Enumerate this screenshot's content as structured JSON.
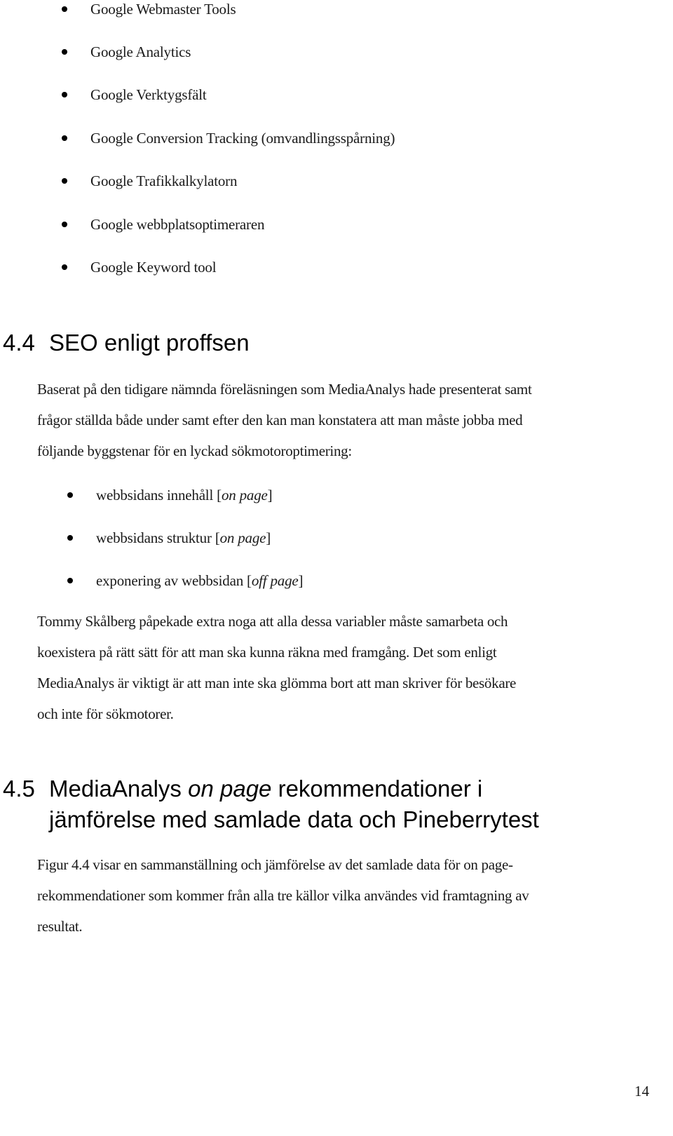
{
  "tools_list": {
    "items": [
      "Google Webmaster Tools",
      "Google Analytics",
      "Google Verktygsfält",
      "Google Conversion Tracking (omvandlingsspårning)",
      "Google Trafikkalkylatorn",
      "Google webbplatsoptimeraren",
      "Google Keyword tool"
    ]
  },
  "section_4_4": {
    "number": "4.4",
    "title": "SEO enligt proffsen",
    "intro_lines": [
      "Baserat på den tidigare nämnda föreläsningen som MediaAnalys hade presenterat samt",
      "frågor ställda både under samt efter den kan man konstatera att man måste jobba med",
      "följande byggstenar för en lyckad sökmotoroptimering:"
    ],
    "building_blocks": [
      {
        "text": "webbsidans innehåll [",
        "emphasis": "on page",
        "suffix": "]"
      },
      {
        "text": "webbsidans struktur [",
        "emphasis": "on page",
        "suffix": "]"
      },
      {
        "text": "exponering av webbsidan [",
        "emphasis": "off page",
        "suffix": "]"
      }
    ],
    "conclusion_lines": [
      "Tommy Skålberg påpekade extra noga att alla dessa variabler måste samarbeta och",
      "koexistera på rätt sätt för att man ska kunna räkna med framgång. Det som enligt",
      "MediaAnalys är viktigt är att man inte ska glömma bort att man skriver för besökare",
      "och inte för sökmotorer."
    ]
  },
  "section_4_5": {
    "number": "4.5",
    "title_part1": "MediaAnalys ",
    "title_emphasis": "on page",
    "title_part2": " rekommendationer i",
    "title_line2": "jämförelse med samlade data och Pineberrytest",
    "body_lines": [
      "Figur 4.4 visar en sammanställning och jämförelse av det samlade data för on page-",
      "rekommendationer som kommer från alla tre källor vilka användes vid framtagning av",
      "resultat."
    ]
  },
  "footer": {
    "page_number": "14"
  }
}
